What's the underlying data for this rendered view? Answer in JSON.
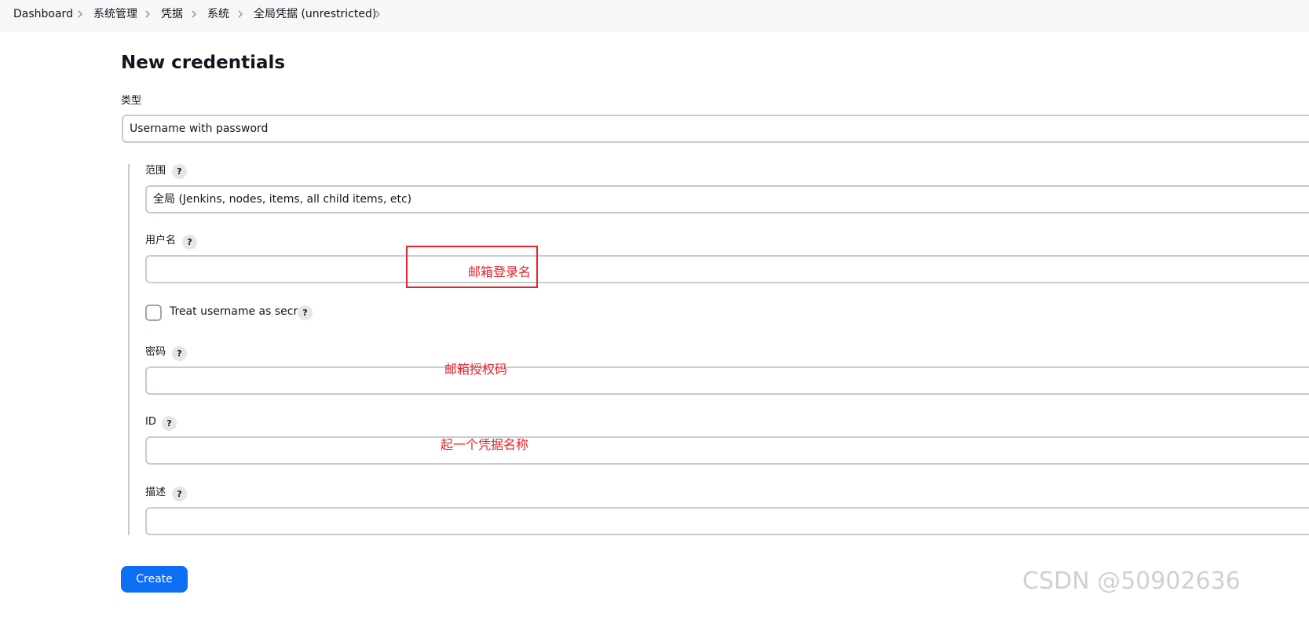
{
  "breadcrumb": {
    "items": [
      {
        "label": "Dashboard"
      },
      {
        "label": "系统管理"
      },
      {
        "label": "凭据"
      },
      {
        "label": "系统"
      },
      {
        "label": "全局凭据 (unrestricted)"
      }
    ]
  },
  "page": {
    "title": "New credentials"
  },
  "form": {
    "kind": {
      "label": "类型",
      "value": "Username with password"
    },
    "scope": {
      "label": "范围",
      "value": "全局 (Jenkins, nodes, items, all child items, etc)"
    },
    "username": {
      "label": "用户名",
      "value": ""
    },
    "username_secret": {
      "label": "Treat username as secret",
      "checked": false
    },
    "password": {
      "label": "密码",
      "value": ""
    },
    "id": {
      "label": "ID",
      "value": ""
    },
    "description": {
      "label": "描述",
      "value": ""
    },
    "help_glyph": "?",
    "create_label": "Create"
  },
  "annotations": {
    "username_note": "邮箱登录名",
    "password_note": "邮箱授权码",
    "id_note": "起一个凭据名称",
    "color": "#e8232b"
  },
  "watermark": "CSDN @50902636",
  "colors": {
    "primary_button": "#0b6ef5",
    "breadcrumb_bg": "#f7f7f8",
    "field_border": "#c5ccd2"
  }
}
